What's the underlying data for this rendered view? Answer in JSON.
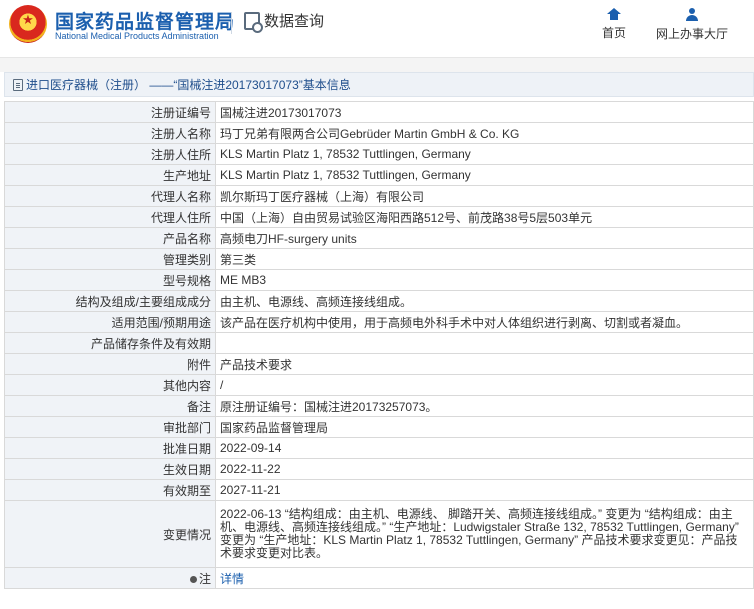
{
  "header": {
    "org_name_cn": "国家药品监督管理局",
    "org_name_en": "National Medical Products Administration",
    "query_label": "数据查询",
    "nav": {
      "home": "首页",
      "online_hall": "网上办事大厅"
    }
  },
  "page_title": "进口医疗器械（注册） ——“国械注进20173017073”基本信息",
  "rows": [
    {
      "label": "注册证编号",
      "value": "国械注进20173017073"
    },
    {
      "label": "注册人名称",
      "value": "玛丁兄弟有限两合公司Gebrüder Martin GmbH & Co. KG"
    },
    {
      "label": "注册人住所",
      "value": "KLS Martin Platz 1, 78532 Tuttlingen, Germany"
    },
    {
      "label": "生产地址",
      "value": "KLS Martin Platz 1, 78532 Tuttlingen, Germany"
    },
    {
      "label": "代理人名称",
      "value": "凯尔斯玛丁医疗器械（上海）有限公司"
    },
    {
      "label": "代理人住所",
      "value": "中国（上海）自由贸易试验区海阳西路512号、前茂路38号5层503单元"
    },
    {
      "label": "产品名称",
      "value": "高频电刀HF-surgery units"
    },
    {
      "label": "管理类别",
      "value": "第三类"
    },
    {
      "label": "型号规格",
      "value": "ME MB3"
    },
    {
      "label": "结构及组成/主要组成成分",
      "value": "由主机、电源线、高频连接线组成。"
    },
    {
      "label": "适用范围/预期用途",
      "value": "该产品在医疗机构中使用，用于高频电外科手术中对人体组织进行剥离、切割或者凝血。"
    },
    {
      "label": "产品储存条件及有效期",
      "value": ""
    },
    {
      "label": "附件",
      "value": "产品技术要求"
    },
    {
      "label": "其他内容",
      "value": "/"
    },
    {
      "label": "备注",
      "value": "原注册证编号：国械注进20173257073。"
    },
    {
      "label": "审批部门",
      "value": "国家药品监督管理局"
    },
    {
      "label": "批准日期",
      "value": "2022-09-14"
    },
    {
      "label": "生效日期",
      "value": "2022-11-22"
    },
    {
      "label": "有效期至",
      "value": "2027-11-21"
    }
  ],
  "change_row": {
    "label": "变更情况",
    "value": "2022-06-13 “结构组成：由主机、电源线、 脚踏开关、高频连接线组成。” 变更为 “结构组成：由主机、电源线、高频连接线组成。” “生产地址：Ludwigstaler Straße 132, 78532 Tuttlingen, Germany” 变更为 “生产地址：KLS Martin Platz 1, 78532 Tuttlingen, Germany” 产品技术要求变更见：产品技术要求变更对比表。"
  },
  "note_row": {
    "label": "注",
    "link": "详情"
  }
}
